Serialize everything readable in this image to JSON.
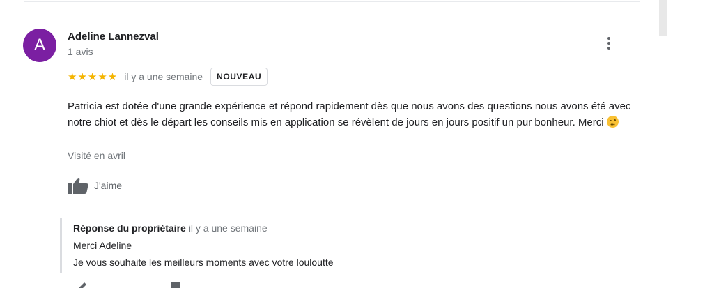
{
  "review": {
    "avatar_letter": "A",
    "avatar_color": "#7b1fa2",
    "author": "Adeline Lannezval",
    "reviews_count": "1 avis",
    "rating": 5,
    "stars": "★★★★★",
    "star_color": "#f4b400",
    "time": "il y a une semaine",
    "badge": "NOUVEAU",
    "text": "Patricia est dotée d'une grande expérience et répond rapidement dès que nous avons des questions nous avons été avec notre chiot et dès le départ les conseils mis en application se révèlent de jours en jours positif un pur bonheur. Merci",
    "emoji": "winking-face",
    "visited": "Visité en avril",
    "like_label": "J'aime",
    "menu_icon": "more-vert-icon"
  },
  "reply": {
    "owner_label": "Réponse du propriétaire",
    "time": "il y a une semaine",
    "line1": "Merci Adeline",
    "line2": "Je vous souhaite les meilleurs moments avec votre louloutte"
  },
  "owner_actions": {
    "edit_icon": "pencil-icon",
    "delete_icon": "trash-icon"
  }
}
